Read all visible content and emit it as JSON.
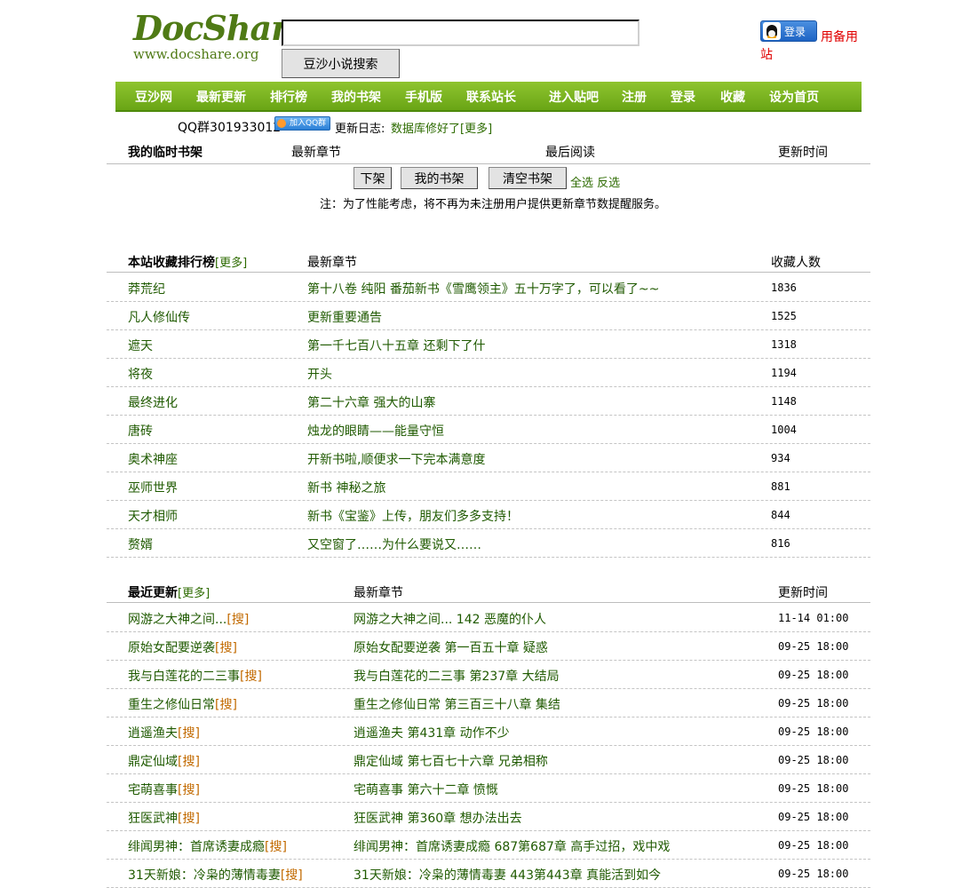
{
  "header": {
    "logo_title": "DocShare",
    "logo_url": "www.docshare.org",
    "search_value": "",
    "search_button": "豆沙小说搜索",
    "qq_login": "登录",
    "backup_site": "用备用站"
  },
  "nav": [
    "豆沙网",
    "最新更新",
    "排行榜",
    "我的书架",
    "手机版",
    "联系站长",
    "进入贴吧",
    "注册",
    "登录",
    "收藏",
    "设为首页"
  ],
  "info": {
    "qq_group": "QQ群301933012",
    "join_qq": "加入QQ群",
    "changelog_label": "更新日志:",
    "changelog_text": "数据库修好了[更多]"
  },
  "shelf": {
    "col_title": "我的临时书架",
    "col_latest": "最新章节",
    "col_last_read": "最后阅读",
    "col_time": "更新时间",
    "btn_remove": "下架",
    "btn_my_shelf": "我的书架",
    "btn_clear": "清空书架",
    "select_all": "全选",
    "invert": "反选",
    "notice": "注：为了性能考虑，将不再为未注册用户提供更新章节数提醒服务。"
  },
  "ranking": {
    "title": "本站收藏排行榜",
    "more": "[更多]",
    "col_latest": "最新章节",
    "col_count": "收藏人数",
    "rows": [
      {
        "book": "莽荒纪",
        "chapter": "第十八卷 纯阳 番茄新书《雪鹰领主》五十万字了，可以看了~~",
        "count": "1836"
      },
      {
        "book": "凡人修仙传",
        "chapter": "更新重要通告",
        "count": "1525"
      },
      {
        "book": "遮天",
        "chapter": "第一千七百八十五章 还剩下了什",
        "count": "1318"
      },
      {
        "book": "将夜",
        "chapter": "开头",
        "count": "1194"
      },
      {
        "book": "最终进化",
        "chapter": "第二十六章 强大的山寨",
        "count": "1148"
      },
      {
        "book": "唐砖",
        "chapter": "烛龙的眼睛——能量守恒",
        "count": "1004"
      },
      {
        "book": "奥术神座",
        "chapter": "开新书啦,顺便求一下完本满意度",
        "count": "934"
      },
      {
        "book": "巫师世界",
        "chapter": "新书 神秘之旅",
        "count": "881"
      },
      {
        "book": "天才相师",
        "chapter": "新书《宝鉴》上传，朋友们多多支持！",
        "count": "844"
      },
      {
        "book": "赘婿",
        "chapter": "又空窗了……为什么要说又……",
        "count": "816"
      }
    ]
  },
  "recent": {
    "title": "最近更新",
    "more": "[更多]",
    "col_latest": "最新章节",
    "col_time": "更新时间",
    "sou": "[搜]",
    "rows": [
      {
        "book": "网游之大神之间...",
        "chapter": "网游之大神之间... 142 恶魔的仆人",
        "time": "11-14 01:00"
      },
      {
        "book": "原始女配要逆袭",
        "chapter": "原始女配要逆袭 第一百五十章 疑惑",
        "time": "09-25 18:00"
      },
      {
        "book": "我与白莲花的二三事",
        "chapter": "我与白莲花的二三事 第237章 大结局",
        "time": "09-25 18:00"
      },
      {
        "book": "重生之修仙日常",
        "chapter": "重生之修仙日常 第三百三十八章 集结",
        "time": "09-25 18:00"
      },
      {
        "book": "逍遥渔夫",
        "chapter": "逍遥渔夫 第431章 动作不少",
        "time": "09-25 18:00"
      },
      {
        "book": "鼎定仙域",
        "chapter": "鼎定仙域 第七百七十六章 兄弟相称",
        "time": "09-25 18:00"
      },
      {
        "book": "宅萌喜事",
        "chapter": "宅萌喜事 第六十二章 愤慨",
        "time": "09-25 18:00"
      },
      {
        "book": "狂医武神",
        "chapter": "狂医武神 第360章 想办法出去",
        "time": "09-25 18:00"
      },
      {
        "book": "绯闻男神：首席诱妻成瘾",
        "chapter": "绯闻男神：首席诱妻成瘾 687第687章 高手过招，戏中戏",
        "time": "09-25 18:00"
      },
      {
        "book": "31天新娘：冷枭的薄情毒妻",
        "chapter": "31天新娘：冷枭的薄情毒妻 443第443章 真能活到如今",
        "time": "09-25 18:00"
      }
    ]
  }
}
